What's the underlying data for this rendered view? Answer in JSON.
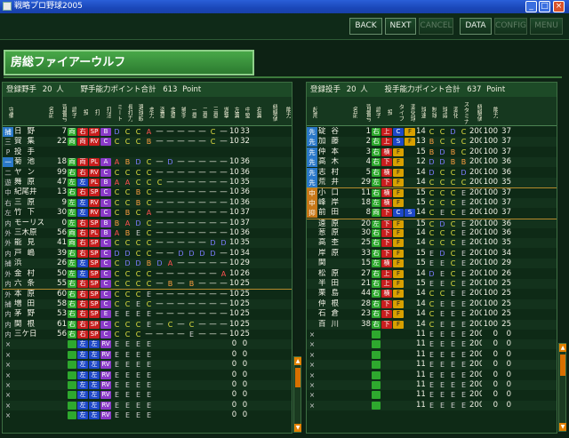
{
  "window": {
    "title": "戦略プロ野球2005",
    "min": "_",
    "max": "□",
    "close": "×"
  },
  "toolbar": {
    "back": "BACK",
    "next": "NEXT",
    "cancel": "CANCEL",
    "data": "DATA",
    "config": "CONFIG",
    "menu": "MENU"
  },
  "team": {
    "name": "房総ファイアーウルフ"
  },
  "batters": {
    "title": "登録野手",
    "count": "20",
    "count_unit": "人",
    "points_label": "野手能力ポイント合計",
    "points": "613",
    "points_unit": "Point",
    "headers": [
      "守備",
      "名前",
      "背番号",
      "調子",
      "投",
      "打",
      "打法",
      "ミート",
      "長打力",
      "選球眼",
      "走力",
      "盗塁",
      "走塁",
      "捕手",
      "一塁",
      "二塁",
      "三塁",
      "遊撃",
      "左翼",
      "中堅",
      "右翼",
      "経験値",
      "能力"
    ],
    "rows": [
      [
        "捕",
        "日野",
        "7",
        "両",
        "右",
        "SP",
        "B",
        "D",
        "C",
        "C",
        "A",
        "—",
        "—",
        "—",
        "—",
        "—",
        "C",
        "—",
        "100",
        "33"
      ],
      [
        "三",
        "賀集",
        "22",
        "両",
        "両",
        "RV",
        "C",
        "C",
        "C",
        "C",
        "B",
        "—",
        "—",
        "—",
        "—",
        "—",
        "C",
        "—",
        "100",
        "32"
      ],
      [
        "P",
        "投手",
        "",
        "",
        "",
        "",
        "",
        "",
        "",
        "",
        "",
        "",
        "",
        "",
        "",
        "",
        "",
        "",
        "",
        ""
      ],
      [
        "一",
        "菊池",
        "18",
        "両",
        "両",
        "PL",
        "A",
        "A",
        "B",
        "D",
        "C",
        "—",
        "D",
        "—",
        "—",
        "—",
        "—",
        "—",
        "100",
        "36"
      ],
      [
        "二",
        "ヤン",
        "99",
        "右",
        "右",
        "RV",
        "C",
        "C",
        "C",
        "C",
        "C",
        "—",
        "—",
        "—",
        "—",
        "—",
        "—",
        "—",
        "100",
        "36"
      ],
      [
        "遊",
        "舞原",
        "47",
        "左",
        "左",
        "PL",
        "B",
        "A",
        "A",
        "C",
        "C",
        "C",
        "—",
        "—",
        "—",
        "—",
        "—",
        "—",
        "100",
        "35"
      ],
      [
        "中",
        "紀尾井",
        "13",
        "右",
        "右",
        "SP",
        "C",
        "C",
        "C",
        "B",
        "C",
        "—",
        "—",
        "—",
        "—",
        "—",
        "—",
        "—",
        "100",
        "36"
      ],
      [
        "右",
        "三原",
        "9",
        "左",
        "左",
        "RV",
        "C",
        "C",
        "C",
        "B",
        "C",
        "—",
        "—",
        "—",
        "—",
        "—",
        "—",
        "—",
        "100",
        "36"
      ],
      [
        "左",
        "竹下",
        "30",
        "左",
        "左",
        "RV",
        "C",
        "C",
        "B",
        "C",
        "A",
        "—",
        "—",
        "—",
        "—",
        "—",
        "—",
        "—",
        "100",
        "37"
      ],
      [
        "内",
        "モーリス",
        "0",
        "左",
        "右",
        "SP",
        "B",
        "B",
        "A",
        "D",
        "C",
        "—",
        "—",
        "—",
        "—",
        "—",
        "—",
        "—",
        "100",
        "37"
      ],
      [
        "外",
        "三木原",
        "56",
        "両",
        "右",
        "PL",
        "B",
        "A",
        "B",
        "E",
        "C",
        "—",
        "—",
        "—",
        "—",
        "—",
        "—",
        "—",
        "100",
        "36"
      ],
      [
        "外",
        "能見",
        "41",
        "両",
        "右",
        "SP",
        "C",
        "C",
        "C",
        "C",
        "C",
        "—",
        "—",
        "—",
        "—",
        "—",
        "D",
        "D",
        "100",
        "35"
      ],
      [
        "内",
        "戸嶋",
        "39",
        "右",
        "右",
        "SP",
        "C",
        "D",
        "D",
        "C",
        "C",
        "—",
        "—",
        "D",
        "D",
        "D",
        "D",
        "—",
        "100",
        "34"
      ],
      [
        "捕",
        "浜",
        "26",
        "左",
        "左",
        "SP",
        "C",
        "C",
        "D",
        "D",
        "B",
        "D",
        "A",
        "—",
        "—",
        "—",
        "—",
        "—",
        "100",
        "29"
      ],
      [
        "外",
        "金村",
        "50",
        "左",
        "左",
        "SP",
        "C",
        "C",
        "C",
        "C",
        "C",
        "—",
        "—",
        "—",
        "—",
        "—",
        "—",
        "A",
        "100",
        "26"
      ],
      [
        "内",
        "六条",
        "55",
        "右",
        "右",
        "SP",
        "C",
        "C",
        "C",
        "C",
        "C",
        "—",
        "B",
        "—",
        "B",
        "—",
        "—",
        "—",
        "100",
        "25"
      ],
      [
        "外",
        "本原",
        "60",
        "右",
        "右",
        "SP",
        "C",
        "C",
        "C",
        "C",
        "E",
        "—",
        "—",
        "—",
        "—",
        "—",
        "—",
        "—",
        "100",
        "25"
      ],
      [
        "捕",
        "増田",
        "58",
        "右",
        "右",
        "SP",
        "C",
        "C",
        "C",
        "E",
        "C",
        "—",
        "—",
        "—",
        "—",
        "—",
        "—",
        "—",
        "100",
        "25"
      ],
      [
        "内",
        "茅野",
        "53",
        "右",
        "右",
        "SP",
        "E",
        "E",
        "E",
        "E",
        "E",
        "—",
        "—",
        "—",
        "—",
        "—",
        "—",
        "—",
        "100",
        "25"
      ],
      [
        "内",
        "関根",
        "61",
        "右",
        "右",
        "SP",
        "C",
        "C",
        "C",
        "C",
        "E",
        "—",
        "C",
        "—",
        "C",
        "—",
        "—",
        "—",
        "100",
        "25"
      ],
      [
        "内",
        "三ケ日",
        "56",
        "右",
        "右",
        "SP",
        "C",
        "C",
        "C",
        "C",
        "—",
        "—",
        "—",
        "—",
        "E",
        "—",
        "—",
        "—",
        "100",
        "25"
      ],
      [
        "×",
        "",
        "",
        "",
        "",
        "",
        "E",
        "E",
        "E",
        "E",
        "E",
        "",
        "",
        "",
        "",
        "",
        "",
        "",
        "0",
        "0"
      ],
      [
        "×",
        "",
        "",
        "",
        "",
        "",
        "E",
        "E",
        "E",
        "E",
        "E",
        "",
        "",
        "",
        "",
        "",
        "",
        "",
        "0",
        "0"
      ],
      [
        "×",
        "",
        "",
        "",
        "",
        "",
        "E",
        "E",
        "E",
        "E",
        "E",
        "",
        "",
        "",
        "",
        "",
        "",
        "",
        "0",
        "0"
      ],
      [
        "×",
        "",
        "",
        "",
        "",
        "",
        "E",
        "E",
        "E",
        "E",
        "E",
        "",
        "",
        "",
        "",
        "",
        "",
        "",
        "0",
        "0"
      ],
      [
        "×",
        "",
        "",
        "",
        "",
        "",
        "E",
        "E",
        "E",
        "E",
        "E",
        "",
        "",
        "",
        "",
        "",
        "",
        "",
        "0",
        "0"
      ],
      [
        "×",
        "",
        "",
        "",
        "",
        "",
        "E",
        "E",
        "E",
        "E",
        "E",
        "",
        "",
        "",
        "",
        "",
        "",
        "",
        "0",
        "0"
      ],
      [
        "×",
        "",
        "",
        "",
        "",
        "",
        "E",
        "E",
        "E",
        "E",
        "E",
        "",
        "",
        "",
        "",
        "",
        "",
        "",
        "0",
        "0"
      ],
      [
        "×",
        "",
        "",
        "",
        "",
        "",
        "E",
        "E",
        "E",
        "E",
        "E",
        "",
        "",
        "",
        "",
        "",
        "",
        "",
        "0",
        "0"
      ]
    ]
  },
  "pitchers": {
    "title": "登録投手",
    "count": "20",
    "count_unit": "人",
    "points_label": "投手能力ポイント合計",
    "points": "637",
    "points_unit": "Point",
    "headers": [
      "起用",
      "名前",
      "背番号",
      "調子",
      "投",
      "タイプ",
      "変化球",
      "球速",
      "制球",
      "球威",
      "変化",
      "スタミナ",
      "経験値",
      "能力"
    ],
    "rows": [
      [
        "先",
        "碇谷",
        "1",
        "右",
        "上",
        "C",
        "F",
        "145",
        "C",
        "C",
        "D",
        "C",
        "200",
        "100",
        "37"
      ],
      [
        "先",
        "加藤",
        "2",
        "右",
        "上",
        "S",
        "F",
        "130",
        "B",
        "C",
        "C",
        "C",
        "200",
        "100",
        "37"
      ],
      [
        "先",
        "仲本",
        "3",
        "右",
        "横",
        "F",
        "",
        "150",
        "B",
        "D",
        "B",
        "C",
        "200",
        "100",
        "37"
      ],
      [
        "先",
        "高木",
        "4",
        "右",
        "下",
        "F",
        "",
        "126",
        "D",
        "D",
        "B",
        "B",
        "200",
        "100",
        "36"
      ],
      [
        "先",
        "志村",
        "5",
        "右",
        "横",
        "F",
        "",
        "145",
        "D",
        "C",
        "C",
        "D",
        "200",
        "100",
        "36"
      ],
      [
        "先",
        "荒井",
        "29",
        "左",
        "下",
        "F",
        "",
        "145",
        "C",
        "C",
        "C",
        "C",
        "200",
        "100",
        "35"
      ],
      [
        "中",
        "小口",
        "11",
        "右",
        "横",
        "F",
        "",
        "150",
        "C",
        "C",
        "C",
        "E",
        "200",
        "100",
        "37"
      ],
      [
        "中",
        "峰岸",
        "18",
        "左",
        "横",
        "F",
        "",
        "150",
        "C",
        "C",
        "C",
        "E",
        "200",
        "100",
        "37"
      ],
      [
        "抑",
        "前田",
        "8",
        "両",
        "下",
        "C",
        "S",
        "145",
        "C",
        "E",
        "C",
        "E",
        "200",
        "100",
        "37"
      ],
      [
        "",
        "遠原",
        "20",
        "左",
        "下",
        "F",
        "",
        "150",
        "C",
        "D",
        "C",
        "E",
        "200",
        "100",
        "36"
      ],
      [
        "",
        "葱原",
        "30",
        "右",
        "下",
        "F",
        "",
        "140",
        "C",
        "C",
        "C",
        "E",
        "200",
        "100",
        "36"
      ],
      [
        "",
        "高杢",
        "25",
        "右",
        "下",
        "F",
        "",
        "145",
        "C",
        "C",
        "C",
        "E",
        "200",
        "100",
        "35"
      ],
      [
        "",
        "岸原",
        "33",
        "右",
        "下",
        "F",
        "",
        "150",
        "E",
        "D",
        "C",
        "E",
        "200",
        "100",
        "34"
      ],
      [
        "",
        "関",
        "15",
        "左",
        "横",
        "F",
        "",
        "150",
        "E",
        "E",
        "C",
        "E",
        "200",
        "100",
        "29"
      ],
      [
        "",
        "松原",
        "27",
        "右",
        "上",
        "F",
        "",
        "145",
        "D",
        "E",
        "C",
        "E",
        "200",
        "100",
        "26"
      ],
      [
        "",
        "半田",
        "21",
        "右",
        "上",
        "F",
        "",
        "150",
        "E",
        "E",
        "C",
        "E",
        "200",
        "100",
        "25"
      ],
      [
        "",
        "栗島",
        "44",
        "右",
        "横",
        "F",
        "",
        "145",
        "C",
        "C",
        "E",
        "E",
        "200",
        "100",
        "25"
      ],
      [
        "",
        "仲根",
        "28",
        "右",
        "下",
        "F",
        "",
        "145",
        "C",
        "E",
        "E",
        "E",
        "200",
        "100",
        "25"
      ],
      [
        "",
        "石倉",
        "23",
        "右",
        "下",
        "F",
        "",
        "145",
        "C",
        "E",
        "E",
        "E",
        "200",
        "100",
        "25"
      ],
      [
        "",
        "百川",
        "38",
        "右",
        "下",
        "F",
        "",
        "145",
        "C",
        "E",
        "E",
        "E",
        "200",
        "100",
        "25"
      ],
      [
        "×",
        "",
        "",
        "",
        "",
        "",
        "",
        "110",
        "E",
        "E",
        "E",
        "E",
        "200",
        "0",
        "0"
      ],
      [
        "×",
        "",
        "",
        "",
        "",
        "",
        "",
        "110",
        "E",
        "E",
        "E",
        "E",
        "200",
        "0",
        "0"
      ],
      [
        "×",
        "",
        "",
        "",
        "",
        "",
        "",
        "110",
        "E",
        "E",
        "E",
        "E",
        "200",
        "0",
        "0"
      ],
      [
        "×",
        "",
        "",
        "",
        "",
        "",
        "",
        "110",
        "E",
        "E",
        "E",
        "E",
        "200",
        "0",
        "0"
      ],
      [
        "×",
        "",
        "",
        "",
        "",
        "",
        "",
        "110",
        "E",
        "E",
        "E",
        "E",
        "200",
        "0",
        "0"
      ],
      [
        "×",
        "",
        "",
        "",
        "",
        "",
        "",
        "110",
        "E",
        "E",
        "E",
        "E",
        "200",
        "0",
        "0"
      ],
      [
        "×",
        "",
        "",
        "",
        "",
        "",
        "",
        "110",
        "E",
        "E",
        "E",
        "E",
        "200",
        "0",
        "0"
      ],
      [
        "×",
        "",
        "",
        "",
        "",
        "",
        "",
        "110",
        "E",
        "E",
        "E",
        "E",
        "200",
        "0",
        "0"
      ]
    ]
  },
  "scroll": {
    "up": "▲",
    "down": "▼"
  }
}
